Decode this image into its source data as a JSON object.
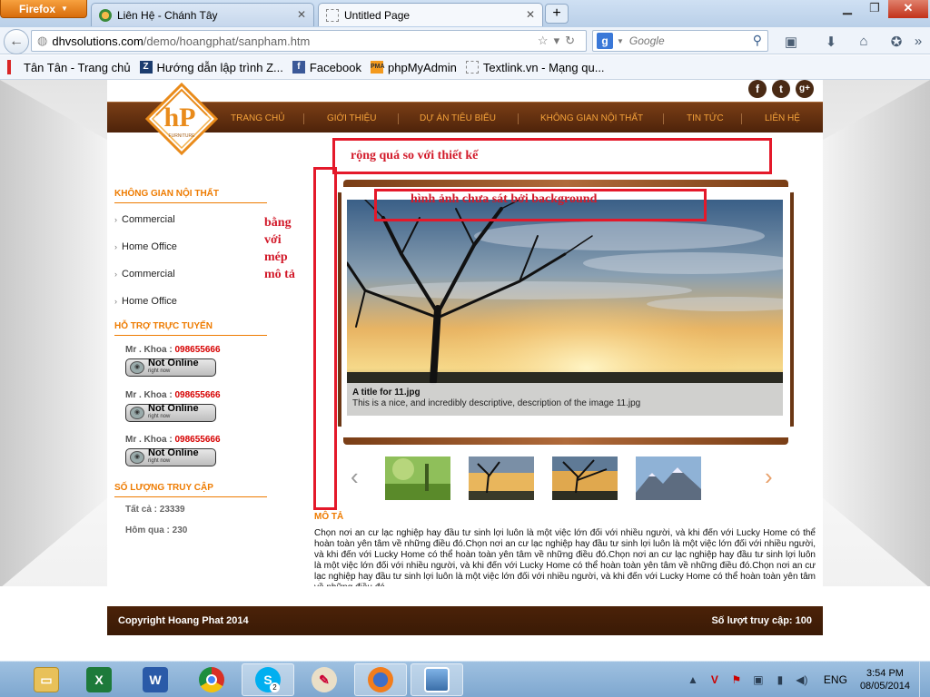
{
  "browser": {
    "app_button": "Firefox",
    "tabs": [
      {
        "title": "Liên Hệ - Chánh Tây"
      },
      {
        "title": "Untitled Page"
      }
    ],
    "url_host": "dhvsolutions.com",
    "url_path": "/demo/hoangphat/sanpham.htm",
    "search_placeholder": "Google",
    "bookmarks": [
      {
        "label": "Tân Tân - Trang chủ"
      },
      {
        "label": "Hướng dẫn lập trình Z..."
      },
      {
        "label": "Facebook"
      },
      {
        "label": "phpMyAdmin"
      },
      {
        "label": "Textlink.vn - Mạng qu..."
      }
    ]
  },
  "site": {
    "logo_text": "hP",
    "logo_sub": "FURNITURE",
    "social": [
      "f",
      "t",
      "g+"
    ],
    "menu": [
      "TRANG CHỦ",
      "GIỚI THIỆU",
      "DỰ ÁN TIÊU BIỂU",
      "KHÔNG GIAN NỘI THẤT",
      "TIN TỨC",
      "LIÊN HỆ"
    ],
    "sidebar": {
      "space_title": "KHÔNG GIAN NỘI THẤT",
      "space_items": [
        "Commercial",
        "Home Office",
        "Commercial",
        "Home Office"
      ],
      "support_title": "HỖ TRỢ TRỰC TUYẾN",
      "supporters": [
        {
          "name": "Mr . Khoa : ",
          "phone": "098655666",
          "status": "Not Online",
          "status_sub": "right now"
        },
        {
          "name": "Mr . Khoa : ",
          "phone": "098655666",
          "status": "Not Online",
          "status_sub": "right now"
        },
        {
          "name": "Mr . Khoa : ",
          "phone": "098655666",
          "status": "Not Online",
          "status_sub": "right now"
        }
      ],
      "visits_title": "SỐ LƯỢNG TRUY CẬP",
      "visits_total": "Tất cả : 23339",
      "visits_yesterday": "Hôm qua : 230"
    },
    "slide": {
      "title": "A title for 11.jpg",
      "description": "This is a nice, and incredibly descriptive, description of the image 11.jpg"
    },
    "desc_title": "MÔ TẢ",
    "desc_text": "Chọn nơi an cư lạc nghiệp hay đầu tư sinh lợi luôn là một việc lớn đối với nhiều người, và khi đến với Lucky Home có thể hoàn toàn yên tâm về những điều đó.Chọn nơi an cư lạc nghiệp hay đầu tư sinh lợi luôn là một việc lớn đối với nhiều người, và khi đến với Lucky Home có thể hoàn toàn yên tâm về những điều đó.Chọn nơi an cư lạc nghiệp hay đầu tư sinh lợi luôn là một việc lớn đối với nhiều người, và khi đến với Lucky Home có thể hoàn toàn yên tâm về những điều đó.Chọn nơi an cư lạc nghiệp hay đầu tư sinh lợi luôn là một việc lớn đối với nhiều người, và khi đến với Lucky Home có thể hoàn toàn yên tâm về những điều đó.",
    "footer_left": "Copyright Hoang Phat 2014",
    "footer_right": "Số lượt truy cập: 100"
  },
  "annotations": {
    "too_wide": "rộng quá so với thiết kế",
    "image_not_fit": "hình ảnh chưa sát bởi background",
    "align_edge": "bằng\nvới\nmép\nmô tả"
  },
  "taskbar": {
    "language": "ENG",
    "time": "3:54 PM",
    "date": "08/05/2014",
    "skype_badge": "2"
  },
  "colors": {
    "accent_orange": "#ee7b00",
    "brand_brown": "#5a2a0c",
    "annotation_red": "#e4192a"
  }
}
